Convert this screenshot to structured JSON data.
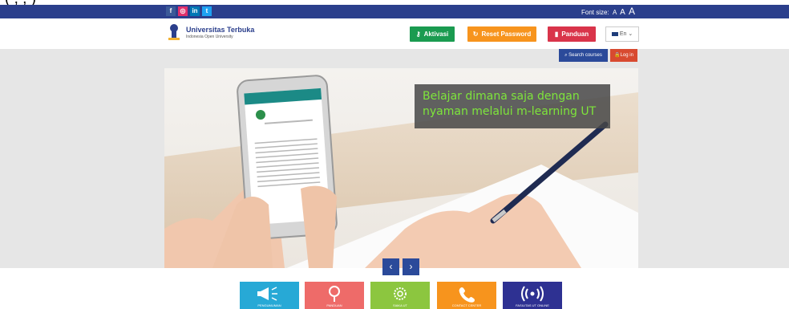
{
  "caption": "(  ,            ,                    )",
  "topbar": {
    "social": [
      "f",
      "◎",
      "in",
      "t"
    ],
    "font_size_label": "Font size:",
    "font_a_small": "A",
    "font_a_medium": "A",
    "font_a_large": "A"
  },
  "header": {
    "logo_title": "Universitas Terbuka",
    "logo_subtitle": "Indonesia Open University",
    "aktivasi": "Aktivasi",
    "reset_password": "Reset Password",
    "panduan": "Panduan",
    "lang": "En ⌄"
  },
  "subheader": {
    "search_courses": "Search courses",
    "login": "Log in"
  },
  "slider": {
    "caption_line1": "Belajar dimana saja dengan",
    "caption_line2": "nyaman melalui m-learning UT",
    "prev": "‹",
    "next": "›"
  },
  "tiles": [
    {
      "label": "PENGUMUMAN",
      "color": "#27a9d6"
    },
    {
      "label": "PANDUAN",
      "color": "#ee6b69"
    },
    {
      "label": "SIAKA UT",
      "color": "#8cc63f"
    },
    {
      "label": "CONTACT CENTER",
      "color": "#f7941d"
    },
    {
      "label": "FASILITAS UT ONLINE",
      "color": "#2e3192"
    }
  ],
  "colors": {
    "topbar": "#2b3f8c",
    "aktivasi": "#1a9b50",
    "reset": "#f7941d",
    "panduan": "#d9344a",
    "search": "#2b4a9a",
    "login": "#d84a30"
  }
}
